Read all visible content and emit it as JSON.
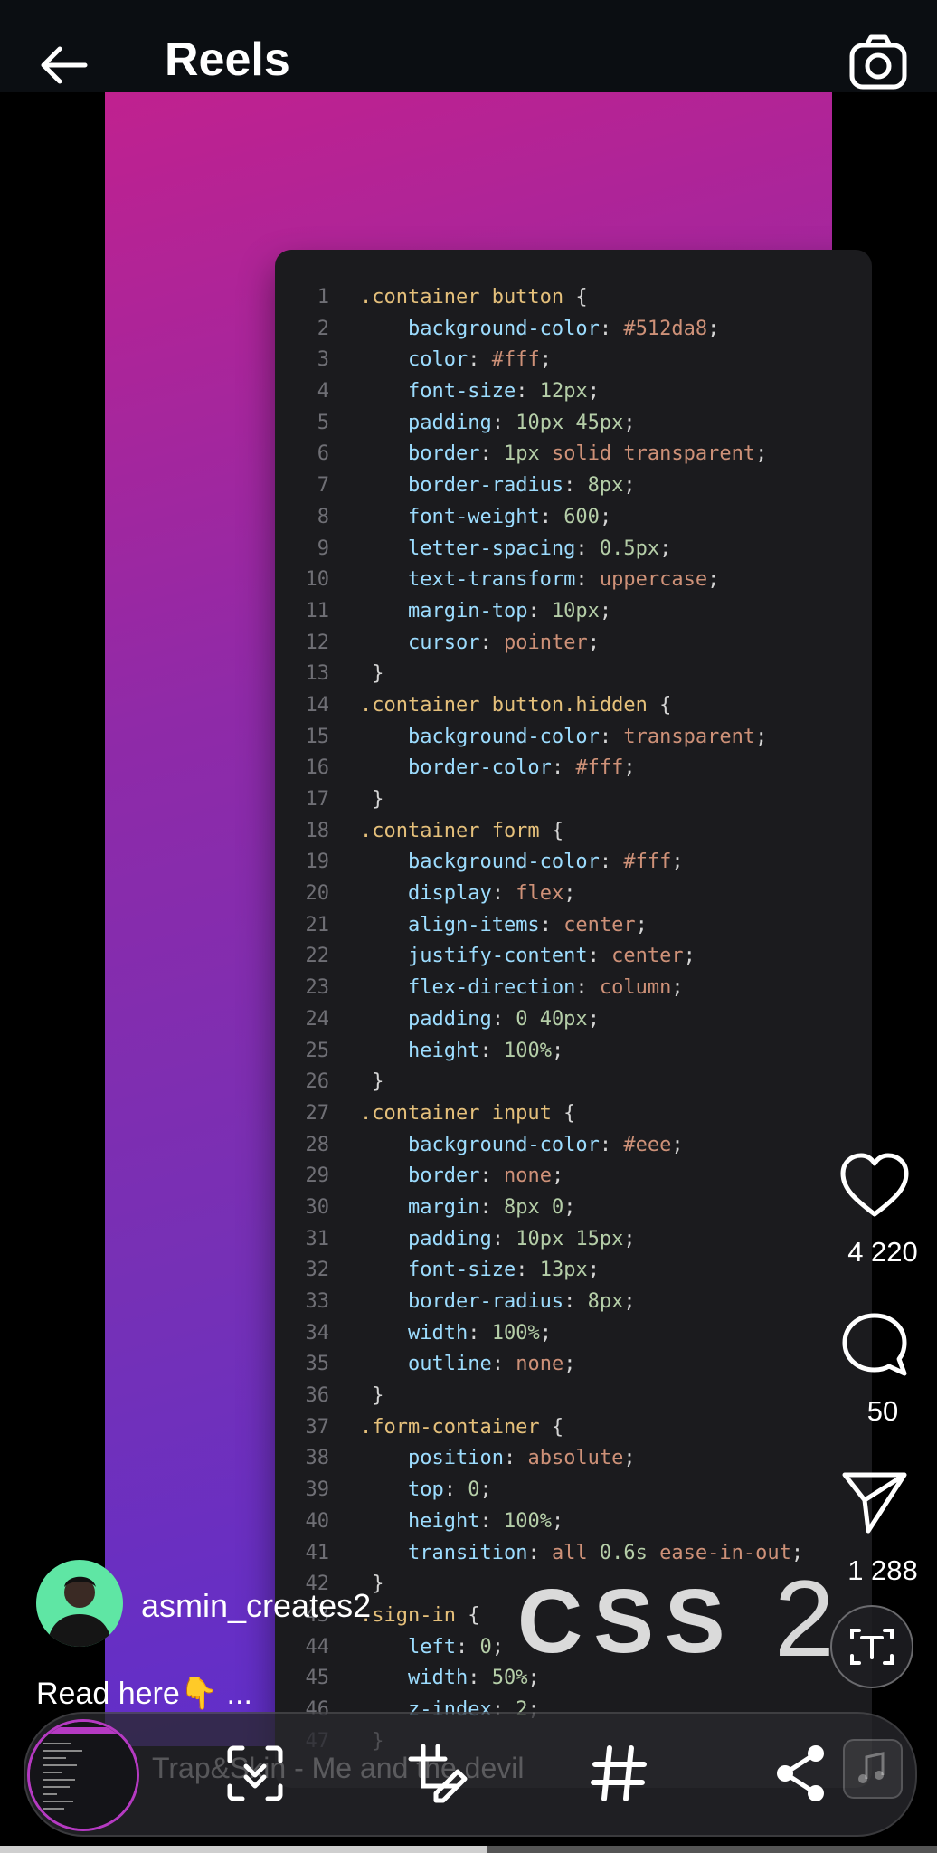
{
  "header": {
    "title": "Reels"
  },
  "code": [
    {
      "n": "1",
      "t": [
        [
          "sel",
          ".container button"
        ],
        [
          "punc",
          " {"
        ]
      ]
    },
    {
      "n": "2",
      "t": [
        [
          "sp",
          "    "
        ],
        [
          "prop",
          "background-color"
        ],
        [
          "punc",
          ": "
        ],
        [
          "val",
          "#512da8"
        ],
        [
          "punc",
          ";"
        ]
      ]
    },
    {
      "n": "3",
      "t": [
        [
          "sp",
          "    "
        ],
        [
          "prop",
          "color"
        ],
        [
          "punc",
          ": "
        ],
        [
          "val",
          "#fff"
        ],
        [
          "punc",
          ";"
        ]
      ]
    },
    {
      "n": "4",
      "t": [
        [
          "sp",
          "    "
        ],
        [
          "prop",
          "font-size"
        ],
        [
          "punc",
          ": "
        ],
        [
          "num",
          "12px"
        ],
        [
          "punc",
          ";"
        ]
      ]
    },
    {
      "n": "5",
      "t": [
        [
          "sp",
          "    "
        ],
        [
          "prop",
          "padding"
        ],
        [
          "punc",
          ": "
        ],
        [
          "num",
          "10px 45px"
        ],
        [
          "punc",
          ";"
        ]
      ]
    },
    {
      "n": "6",
      "t": [
        [
          "sp",
          "    "
        ],
        [
          "prop",
          "border"
        ],
        [
          "punc",
          ": "
        ],
        [
          "num",
          "1px "
        ],
        [
          "val",
          "solid transparent"
        ],
        [
          "punc",
          ";"
        ]
      ]
    },
    {
      "n": "7",
      "t": [
        [
          "sp",
          "    "
        ],
        [
          "prop",
          "border-radius"
        ],
        [
          "punc",
          ": "
        ],
        [
          "num",
          "8px"
        ],
        [
          "punc",
          ";"
        ]
      ]
    },
    {
      "n": "8",
      "t": [
        [
          "sp",
          "    "
        ],
        [
          "prop",
          "font-weight"
        ],
        [
          "punc",
          ": "
        ],
        [
          "num",
          "600"
        ],
        [
          "punc",
          ";"
        ]
      ]
    },
    {
      "n": "9",
      "t": [
        [
          "sp",
          "    "
        ],
        [
          "prop",
          "letter-spacing"
        ],
        [
          "punc",
          ": "
        ],
        [
          "num",
          "0.5px"
        ],
        [
          "punc",
          ";"
        ]
      ]
    },
    {
      "n": "10",
      "t": [
        [
          "sp",
          "    "
        ],
        [
          "prop",
          "text-transform"
        ],
        [
          "punc",
          ": "
        ],
        [
          "val",
          "uppercase"
        ],
        [
          "punc",
          ";"
        ]
      ]
    },
    {
      "n": "11",
      "t": [
        [
          "sp",
          "    "
        ],
        [
          "prop",
          "margin-top"
        ],
        [
          "punc",
          ": "
        ],
        [
          "num",
          "10px"
        ],
        [
          "punc",
          ";"
        ]
      ]
    },
    {
      "n": "12",
      "t": [
        [
          "sp",
          "    "
        ],
        [
          "prop",
          "cursor"
        ],
        [
          "punc",
          ": "
        ],
        [
          "val",
          "pointer"
        ],
        [
          "punc",
          ";"
        ]
      ]
    },
    {
      "n": "13",
      "t": [
        [
          "punc",
          " }"
        ]
      ]
    },
    {
      "n": "14",
      "t": [
        [
          "sel",
          ".container button.hidden"
        ],
        [
          "punc",
          " {"
        ]
      ]
    },
    {
      "n": "15",
      "t": [
        [
          "sp",
          "    "
        ],
        [
          "prop",
          "background-color"
        ],
        [
          "punc",
          ": "
        ],
        [
          "val",
          "transparent"
        ],
        [
          "punc",
          ";"
        ]
      ]
    },
    {
      "n": "16",
      "t": [
        [
          "sp",
          "    "
        ],
        [
          "prop",
          "border-color"
        ],
        [
          "punc",
          ": "
        ],
        [
          "val",
          "#fff"
        ],
        [
          "punc",
          ";"
        ]
      ]
    },
    {
      "n": "17",
      "t": [
        [
          "punc",
          " }"
        ]
      ]
    },
    {
      "n": "18",
      "t": [
        [
          "sel",
          ".container form"
        ],
        [
          "punc",
          " {"
        ]
      ]
    },
    {
      "n": "19",
      "t": [
        [
          "sp",
          "    "
        ],
        [
          "prop",
          "background-color"
        ],
        [
          "punc",
          ": "
        ],
        [
          "val",
          "#fff"
        ],
        [
          "punc",
          ";"
        ]
      ]
    },
    {
      "n": "20",
      "t": [
        [
          "sp",
          "    "
        ],
        [
          "prop",
          "display"
        ],
        [
          "punc",
          ": "
        ],
        [
          "val",
          "flex"
        ],
        [
          "punc",
          ";"
        ]
      ]
    },
    {
      "n": "21",
      "t": [
        [
          "sp",
          "    "
        ],
        [
          "prop",
          "align-items"
        ],
        [
          "punc",
          ": "
        ],
        [
          "val",
          "center"
        ],
        [
          "punc",
          ";"
        ]
      ]
    },
    {
      "n": "22",
      "t": [
        [
          "sp",
          "    "
        ],
        [
          "prop",
          "justify-content"
        ],
        [
          "punc",
          ": "
        ],
        [
          "val",
          "center"
        ],
        [
          "punc",
          ";"
        ]
      ]
    },
    {
      "n": "23",
      "t": [
        [
          "sp",
          "    "
        ],
        [
          "prop",
          "flex-direction"
        ],
        [
          "punc",
          ": "
        ],
        [
          "val",
          "column"
        ],
        [
          "punc",
          ";"
        ]
      ]
    },
    {
      "n": "24",
      "t": [
        [
          "sp",
          "    "
        ],
        [
          "prop",
          "padding"
        ],
        [
          "punc",
          ": "
        ],
        [
          "num",
          "0 40px"
        ],
        [
          "punc",
          ";"
        ]
      ]
    },
    {
      "n": "25",
      "t": [
        [
          "sp",
          "    "
        ],
        [
          "prop",
          "height"
        ],
        [
          "punc",
          ": "
        ],
        [
          "num",
          "100%"
        ],
        [
          "punc",
          ";"
        ]
      ]
    },
    {
      "n": "26",
      "t": [
        [
          "punc",
          " }"
        ]
      ]
    },
    {
      "n": "27",
      "t": [
        [
          "sel",
          ".container input"
        ],
        [
          "punc",
          " {"
        ]
      ]
    },
    {
      "n": "28",
      "t": [
        [
          "sp",
          "    "
        ],
        [
          "prop",
          "background-color"
        ],
        [
          "punc",
          ": "
        ],
        [
          "val",
          "#eee"
        ],
        [
          "punc",
          ";"
        ]
      ]
    },
    {
      "n": "29",
      "t": [
        [
          "sp",
          "    "
        ],
        [
          "prop",
          "border"
        ],
        [
          "punc",
          ": "
        ],
        [
          "val",
          "none"
        ],
        [
          "punc",
          ";"
        ]
      ]
    },
    {
      "n": "30",
      "t": [
        [
          "sp",
          "    "
        ],
        [
          "prop",
          "margin"
        ],
        [
          "punc",
          ": "
        ],
        [
          "num",
          "8px 0"
        ],
        [
          "punc",
          ";"
        ]
      ]
    },
    {
      "n": "31",
      "t": [
        [
          "sp",
          "    "
        ],
        [
          "prop",
          "padding"
        ],
        [
          "punc",
          ": "
        ],
        [
          "num",
          "10px 15px"
        ],
        [
          "punc",
          ";"
        ]
      ]
    },
    {
      "n": "32",
      "t": [
        [
          "sp",
          "    "
        ],
        [
          "prop",
          "font-size"
        ],
        [
          "punc",
          ": "
        ],
        [
          "num",
          "13px"
        ],
        [
          "punc",
          ";"
        ]
      ]
    },
    {
      "n": "33",
      "t": [
        [
          "sp",
          "    "
        ],
        [
          "prop",
          "border-radius"
        ],
        [
          "punc",
          ": "
        ],
        [
          "num",
          "8px"
        ],
        [
          "punc",
          ";"
        ]
      ]
    },
    {
      "n": "34",
      "t": [
        [
          "sp",
          "    "
        ],
        [
          "prop",
          "width"
        ],
        [
          "punc",
          ": "
        ],
        [
          "num",
          "100%"
        ],
        [
          "punc",
          ";"
        ]
      ]
    },
    {
      "n": "35",
      "t": [
        [
          "sp",
          "    "
        ],
        [
          "prop",
          "outline"
        ],
        [
          "punc",
          ": "
        ],
        [
          "val",
          "none"
        ],
        [
          "punc",
          ";"
        ]
      ]
    },
    {
      "n": "36",
      "t": [
        [
          "punc",
          " }"
        ]
      ]
    },
    {
      "n": "37",
      "t": [
        [
          "sel",
          ".form-container"
        ],
        [
          "punc",
          " {"
        ]
      ]
    },
    {
      "n": "38",
      "t": [
        [
          "sp",
          "    "
        ],
        [
          "prop",
          "position"
        ],
        [
          "punc",
          ": "
        ],
        [
          "val",
          "absolute"
        ],
        [
          "punc",
          ";"
        ]
      ]
    },
    {
      "n": "39",
      "t": [
        [
          "sp",
          "    "
        ],
        [
          "prop",
          "top"
        ],
        [
          "punc",
          ": "
        ],
        [
          "num",
          "0"
        ],
        [
          "punc",
          ";"
        ]
      ]
    },
    {
      "n": "40",
      "t": [
        [
          "sp",
          "    "
        ],
        [
          "prop",
          "height"
        ],
        [
          "punc",
          ": "
        ],
        [
          "num",
          "100%"
        ],
        [
          "punc",
          ";"
        ]
      ]
    },
    {
      "n": "41",
      "t": [
        [
          "sp",
          "    "
        ],
        [
          "prop",
          "transition"
        ],
        [
          "punc",
          ": "
        ],
        [
          "val",
          "all "
        ],
        [
          "num",
          "0.6s "
        ],
        [
          "val",
          "ease-in-out"
        ],
        [
          "punc",
          ";"
        ]
      ]
    },
    {
      "n": "42",
      "t": [
        [
          "punc",
          " }"
        ]
      ]
    },
    {
      "n": "43",
      "t": [
        [
          "sel",
          ".sign-in"
        ],
        [
          "punc",
          " {"
        ]
      ]
    },
    {
      "n": "44",
      "t": [
        [
          "sp",
          "    "
        ],
        [
          "prop",
          "left"
        ],
        [
          "punc",
          ": "
        ],
        [
          "num",
          "0"
        ],
        [
          "punc",
          ";"
        ]
      ]
    },
    {
      "n": "45",
      "t": [
        [
          "sp",
          "    "
        ],
        [
          "prop",
          "width"
        ],
        [
          "punc",
          ": "
        ],
        [
          "num",
          "50%"
        ],
        [
          "punc",
          ";"
        ]
      ]
    },
    {
      "n": "46",
      "t": [
        [
          "sp",
          "    "
        ],
        [
          "prop",
          "z-index"
        ],
        [
          "punc",
          ": "
        ],
        [
          "num",
          "2"
        ],
        [
          "punc",
          ";"
        ]
      ]
    },
    {
      "n": "47",
      "t": [
        [
          "punc",
          " }"
        ]
      ]
    }
  ],
  "overlay": {
    "css_text": "CSS",
    "number_text": "2"
  },
  "actions": {
    "likes": "4 220",
    "comments": "50",
    "shares": "1 288"
  },
  "author": {
    "username": "asmin_creates2"
  },
  "caption": {
    "text": "Read here👇 ..."
  },
  "toolbar": {
    "music_text": "Trap&Skin - Me and the devil"
  },
  "playback": {
    "progress": 0.52
  },
  "colors": {
    "accent": "#c0218f",
    "code_bg": "#1b1b1e",
    "avatar_bg": "#5fe6a4"
  },
  "icons": {
    "back": "arrow-left-icon",
    "camera": "camera-icon",
    "like": "heart-icon",
    "comment": "comment-bubble-icon",
    "share": "paper-plane-icon",
    "text_tool": "text-recognition-icon",
    "scan": "scan-icon",
    "edit": "edit-crop-icon",
    "hashtag": "hashtag-icon",
    "share_tb": "share-icon",
    "music": "music-note-icon"
  }
}
